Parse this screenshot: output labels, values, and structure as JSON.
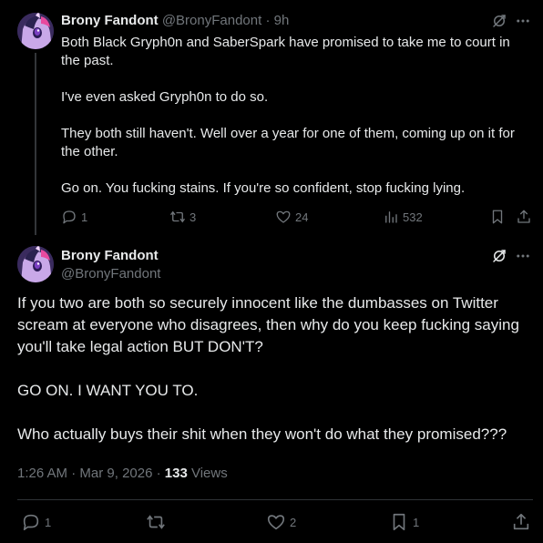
{
  "tweet1": {
    "name": "Brony Fandont",
    "handle": "@BronyFandont",
    "separator": "·",
    "time": "9h",
    "paragraphs": [
      "Both Black Gryph0n and SaberSpark have promised to take me to court in the past.",
      "I've even asked Gryph0n to do so.",
      "They both still haven't. Well over a year for one of them, coming up on it for the other.",
      "Go on. You fucking stains. If you're so confident, stop fucking lying."
    ],
    "replies": "1",
    "reposts": "3",
    "likes": "24",
    "views": "532"
  },
  "tweet2": {
    "name": "Brony Fandont",
    "handle": "@BronyFandont",
    "paragraphs": [
      "If you two are both so securely innocent like the dumbasses on Twitter scream at everyone who disagrees, then why do you keep fucking saying you'll take legal action BUT DON'T?",
      "GO ON. I WANT YOU TO.",
      "Who actually buys their shit when they won't do what they promised???"
    ],
    "time": "1:26 AM",
    "dot": "·",
    "date": "Mar 9, 2026",
    "views_count": "133",
    "views_label": "Views",
    "replies": "1",
    "likes": "2",
    "bookmarks": "1"
  },
  "colors": {
    "background": "#000000",
    "text": "#e7e9ea",
    "muted": "#71767b",
    "divider": "#2f3336"
  },
  "icons": [
    "avatar-pony",
    "grok-icon",
    "more-icon",
    "reply-icon",
    "repost-icon",
    "like-icon",
    "views-icon",
    "bookmark-icon",
    "share-icon"
  ]
}
